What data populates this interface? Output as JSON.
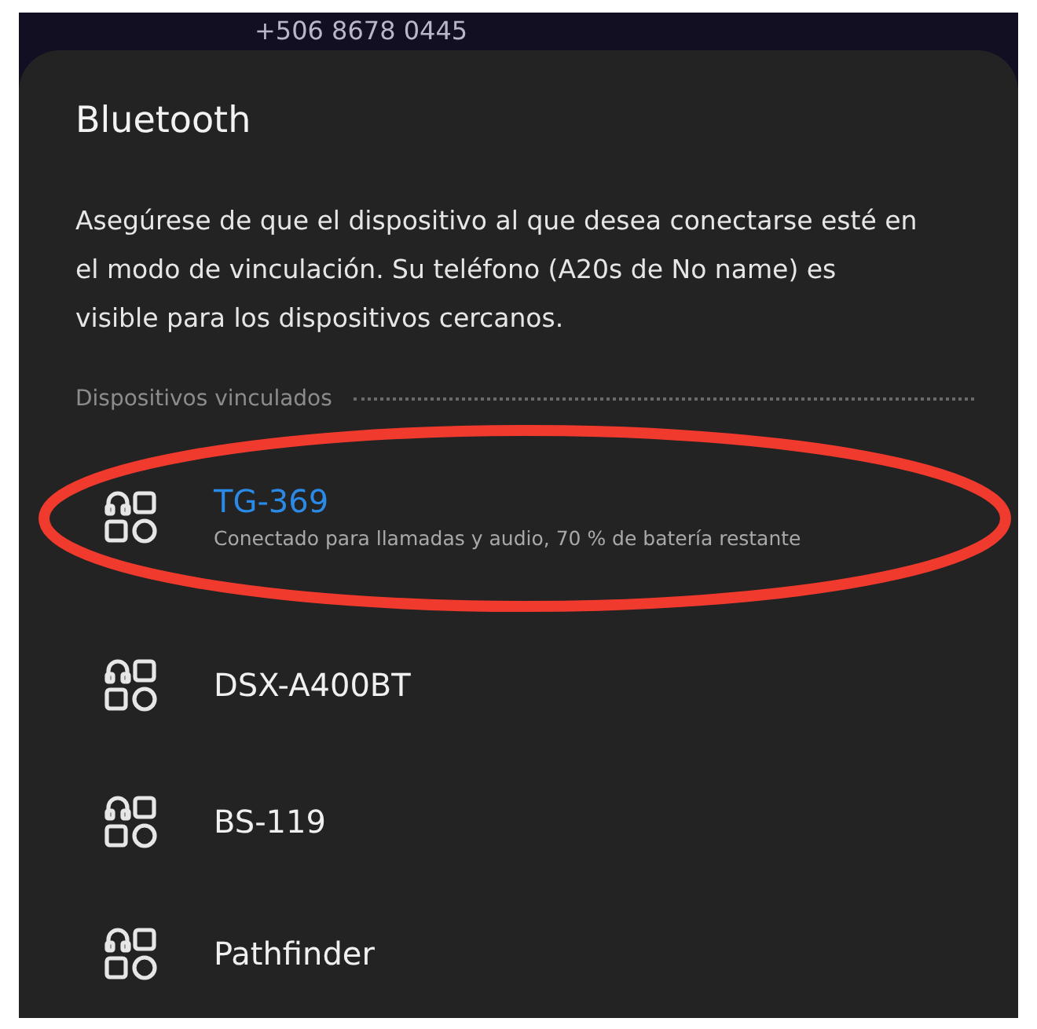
{
  "background": {
    "caller_number": "+506 8678 0445"
  },
  "dialog": {
    "title": "Bluetooth",
    "description": "Asegúrese de que el dispositivo al que desea conectarse esté en el modo de vinculación. Su teléfono (A20s de No name) es visible para los dispositivos cercanos.",
    "section_title": "Dispositivos vinculados",
    "devices": [
      {
        "name": "TG-369",
        "status": "Conectado para llamadas y audio, 70 % de batería restante",
        "connected": true
      },
      {
        "name": "DSX-A400BT",
        "connected": false
      },
      {
        "name": "BS-119",
        "connected": false
      },
      {
        "name": "Pathfinder",
        "connected": false
      }
    ]
  }
}
